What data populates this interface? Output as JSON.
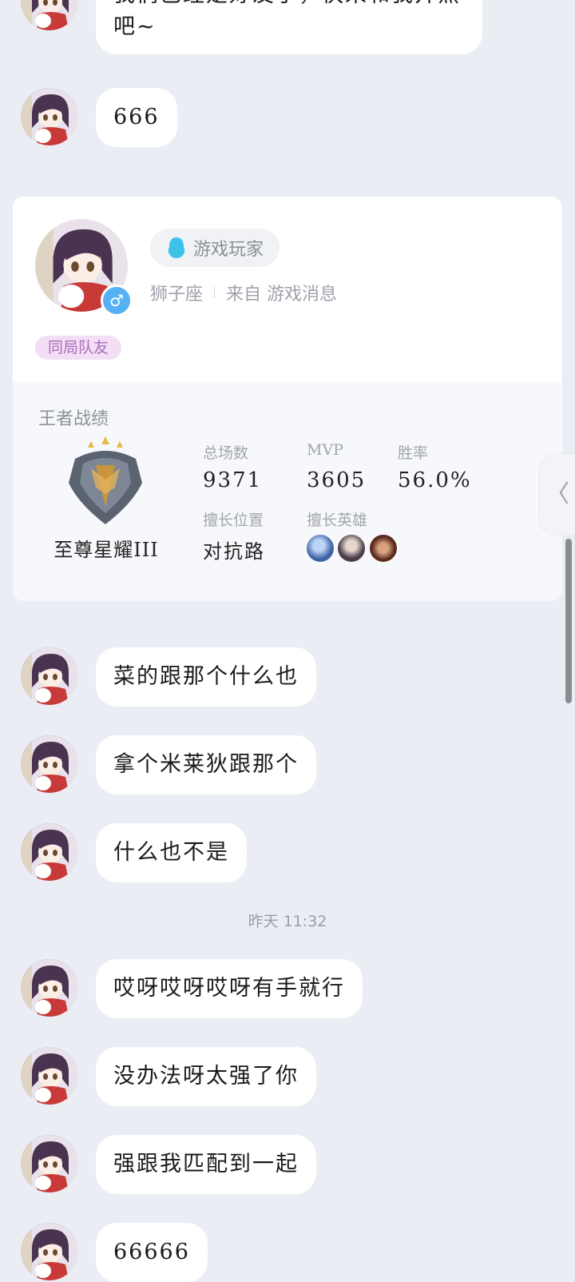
{
  "messages_top": [
    {
      "text": "我们已经是好友了，快来和我开黑吧~"
    },
    {
      "text": "666"
    }
  ],
  "card": {
    "qq_label": "游戏玩家",
    "constellation": "狮子座",
    "source": "来自 游戏消息",
    "gender_symbol": "♂",
    "tag": "同局队友",
    "section_title": "王者战绩",
    "rank_name": "至尊星耀III",
    "stats": {
      "total_games_label": "总场数",
      "total_games": "9371",
      "mvp_label": "MVP",
      "mvp": "3605",
      "winrate_label": "胜率",
      "winrate": "56.0%",
      "position_label": "擅长位置",
      "position": "对抗路",
      "heroes_label": "擅长英雄"
    },
    "colors": {
      "tag_bg": "#f3def6",
      "tag_text": "#a66fb7",
      "gender": "#55b0f4"
    }
  },
  "messages_mid": [
    {
      "text": "菜的跟那个什么也"
    },
    {
      "text": "拿个米莱狄跟那个"
    },
    {
      "text": "什么也不是"
    }
  ],
  "timestamp": "昨天 11:32",
  "messages_bottom": [
    {
      "text": "哎呀哎呀哎呀有手就行"
    },
    {
      "text": "没办法呀太强了你"
    },
    {
      "text": "强跟我匹配到一起"
    },
    {
      "text": "66666"
    }
  ],
  "side_handle_icon": "〈",
  "colors": {
    "background": "#ebedf4",
    "bubble": "#ffffff"
  }
}
